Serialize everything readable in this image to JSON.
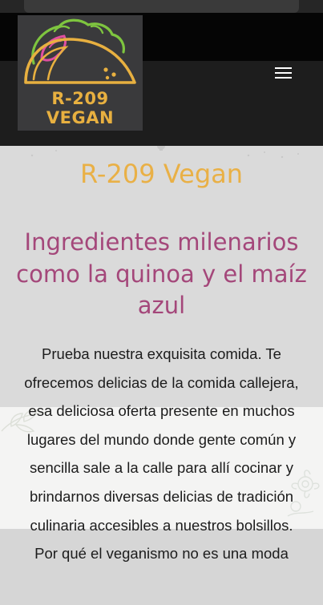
{
  "header": {
    "logo": {
      "line1": "R-209",
      "line2": "VEGAN",
      "colors": {
        "text": "#e8b040",
        "shell": "#e8b040",
        "lettuce": "#7ec53f",
        "filling": "#e04fa0",
        "background": "#3a3a3c"
      }
    },
    "menu_icon": "hamburger-menu-icon"
  },
  "main": {
    "brand_title": "R-209 Vegan",
    "headline": "Ingredientes milenarios como la quinoa y el maíz azul",
    "body": "Prueba nuestra exquisita comida. Te ofrecemos delicias de la comida callejera, esa deliciosa oferta presente en muchos lugares del mundo donde gente común y sencilla sale a la calle para allí cocinar y brindarnos diversas delicias de tradición culinaria accesibles a nuestros bolsillos. Por qué el veganismo no es una moda"
  },
  "colors": {
    "brand_title": "#e9b046",
    "headline": "#a4477a",
    "body_text": "#1c1c1c",
    "header_bg": "#1d1d1d"
  }
}
